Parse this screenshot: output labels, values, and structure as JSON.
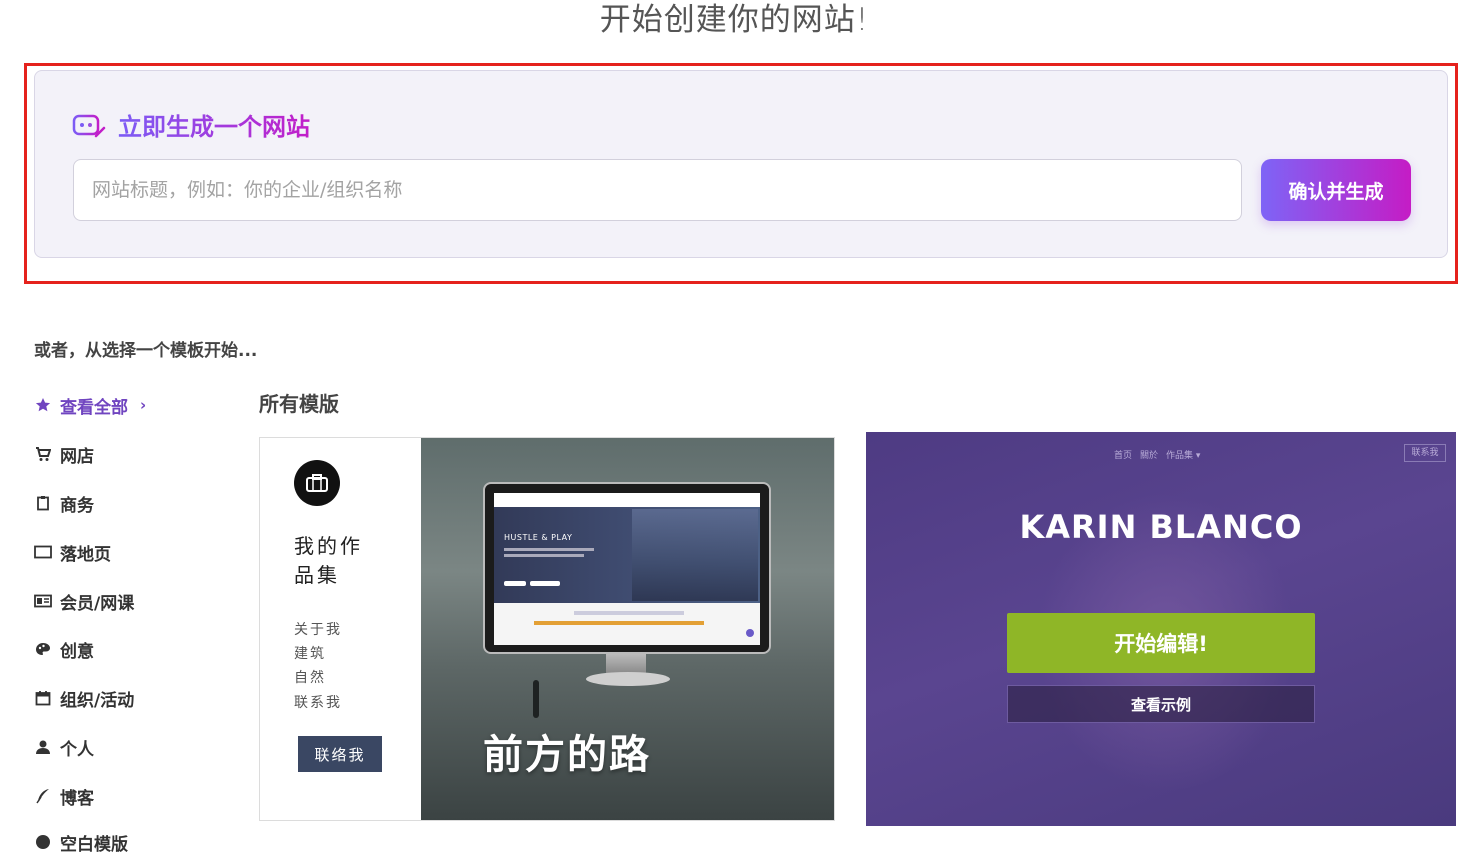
{
  "header": {
    "title": "开始创建你的网站!"
  },
  "generator": {
    "heading": "立即生成一个网站",
    "input_placeholder": "网站标题，例如：你的企业/组织名称",
    "input_value": "",
    "confirm_label": "确认并生成"
  },
  "or_text": "或者，从选择一个模板开始...",
  "sidebar": {
    "items": [
      {
        "label": "查看全部",
        "icon": "star-icon",
        "active": true
      },
      {
        "label": "网店",
        "icon": "cart-icon"
      },
      {
        "label": "商务",
        "icon": "clipboard-icon"
      },
      {
        "label": "落地页",
        "icon": "window-icon"
      },
      {
        "label": "会员/网课",
        "icon": "card-icon"
      },
      {
        "label": "创意",
        "icon": "palette-icon"
      },
      {
        "label": "组织/活动",
        "icon": "calendar-icon"
      },
      {
        "label": "个人",
        "icon": "user-icon"
      },
      {
        "label": "博客",
        "icon": "feather-icon"
      },
      {
        "label": "空白模版",
        "icon": "circle-icon"
      }
    ]
  },
  "section_title": "所有模版",
  "templates": [
    {
      "title": "我的作品集",
      "title_line1": "我的作",
      "title_line2": "品集",
      "nav": [
        "关于我",
        "建筑",
        "自然",
        "联系我"
      ],
      "button": "联络我",
      "banner": "前方的路",
      "screen_heading": "HUSTLE & PLAY"
    },
    {
      "name": "KARIN BLANCO",
      "edit_label": "开始编辑!",
      "demo_label": "查看示例",
      "nav": [
        "首页",
        "關於",
        "作品集 ▾"
      ],
      "nav_button": "联系我"
    }
  ],
  "colors": {
    "accent": "#7045c0",
    "highlight": "#e5221d",
    "edit_green": "#8fb627"
  }
}
